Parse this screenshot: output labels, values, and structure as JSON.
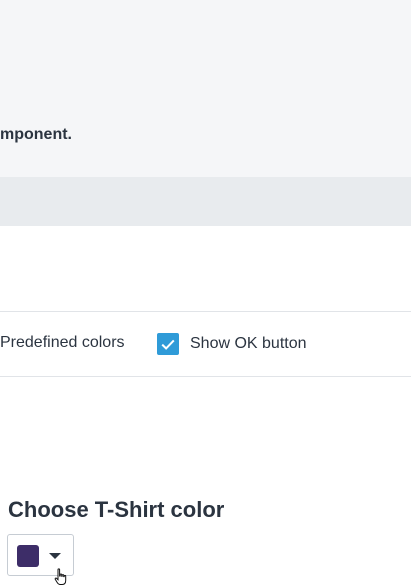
{
  "header": {
    "description_fragment": "mponent."
  },
  "options": {
    "predefined_colors_label": "Predefined colors",
    "show_ok_button_label": "Show OK button",
    "show_ok_button_checked": true
  },
  "demo": {
    "title": "Choose T-Shirt color",
    "selected_color": "#3d2d68"
  },
  "colors": {
    "accent": "#2f9bd8",
    "top_background": "#f5f6f8",
    "band_background": "#e8ebee"
  },
  "icons": {
    "checkbox": "checkmark-icon",
    "dropdown": "chevron-down-icon",
    "cursor": "hand-pointer-icon"
  }
}
